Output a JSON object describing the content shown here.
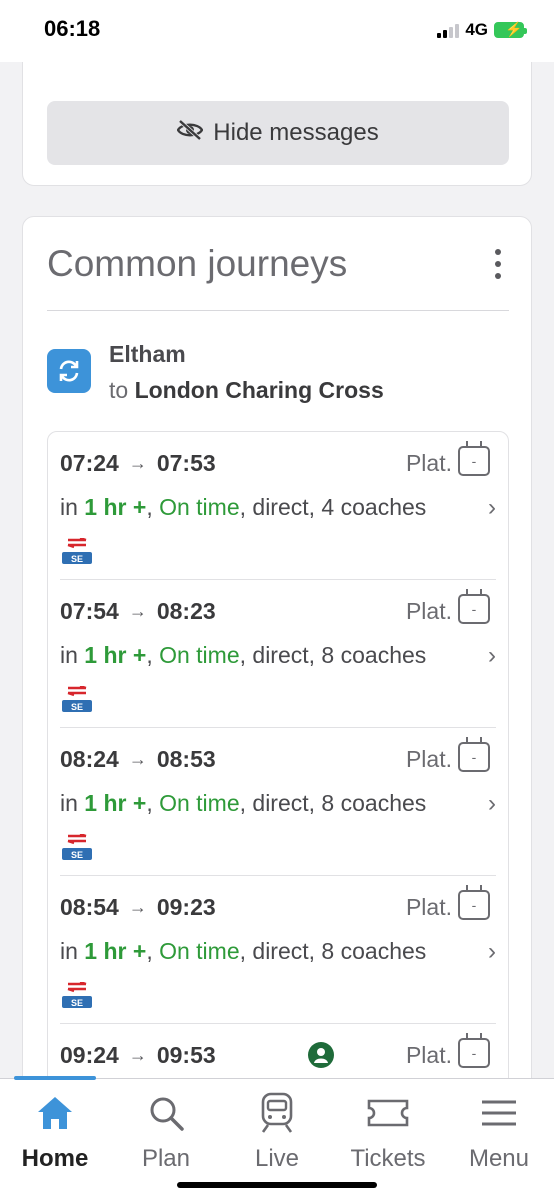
{
  "status": {
    "time": "06:18",
    "network": "4G"
  },
  "messages": {
    "hide_label": "Hide messages",
    "icon": "eye-off-icon"
  },
  "journeys": {
    "title": "Common journeys",
    "route": {
      "from": "Eltham",
      "to_prefix": "to",
      "to": "London Charing Cross"
    },
    "trains": [
      {
        "depart": "07:24",
        "arrive": "07:53",
        "plat_label": "Plat.",
        "plat_value": "-",
        "in_prefix": "in",
        "in_time": "1 hr +",
        "status": "On time",
        "rest": ", direct, 4 coaches",
        "operator": "SE"
      },
      {
        "depart": "07:54",
        "arrive": "08:23",
        "plat_label": "Plat.",
        "plat_value": "-",
        "in_prefix": "in",
        "in_time": "1 hr +",
        "status": "On time",
        "rest": ", direct, 8 coaches",
        "operator": "SE"
      },
      {
        "depart": "08:24",
        "arrive": "08:53",
        "plat_label": "Plat.",
        "plat_value": "-",
        "in_prefix": "in",
        "in_time": "1 hr +",
        "status": "On time",
        "rest": ", direct, 8 coaches",
        "operator": "SE"
      },
      {
        "depart": "08:54",
        "arrive": "09:23",
        "plat_label": "Plat.",
        "plat_value": "-",
        "in_prefix": "in",
        "in_time": "1 hr +",
        "status": "On time",
        "rest": ", direct, 8 coaches",
        "operator": "SE"
      },
      {
        "depart": "09:24",
        "arrive": "09:53",
        "plat_label": "Plat.",
        "plat_value": "-"
      }
    ]
  },
  "tabs": [
    {
      "label": "Home",
      "icon": "home-icon",
      "active": true
    },
    {
      "label": "Plan",
      "icon": "search-icon"
    },
    {
      "label": "Live",
      "icon": "train-icon"
    },
    {
      "label": "Tickets",
      "icon": "ticket-icon"
    },
    {
      "label": "Menu",
      "icon": "menu-icon"
    }
  ],
  "colors": {
    "accent": "#3d93d9",
    "on_time": "#2e9a39",
    "operator_red": "#d7262c",
    "operator_blue": "#2f6fb3"
  }
}
